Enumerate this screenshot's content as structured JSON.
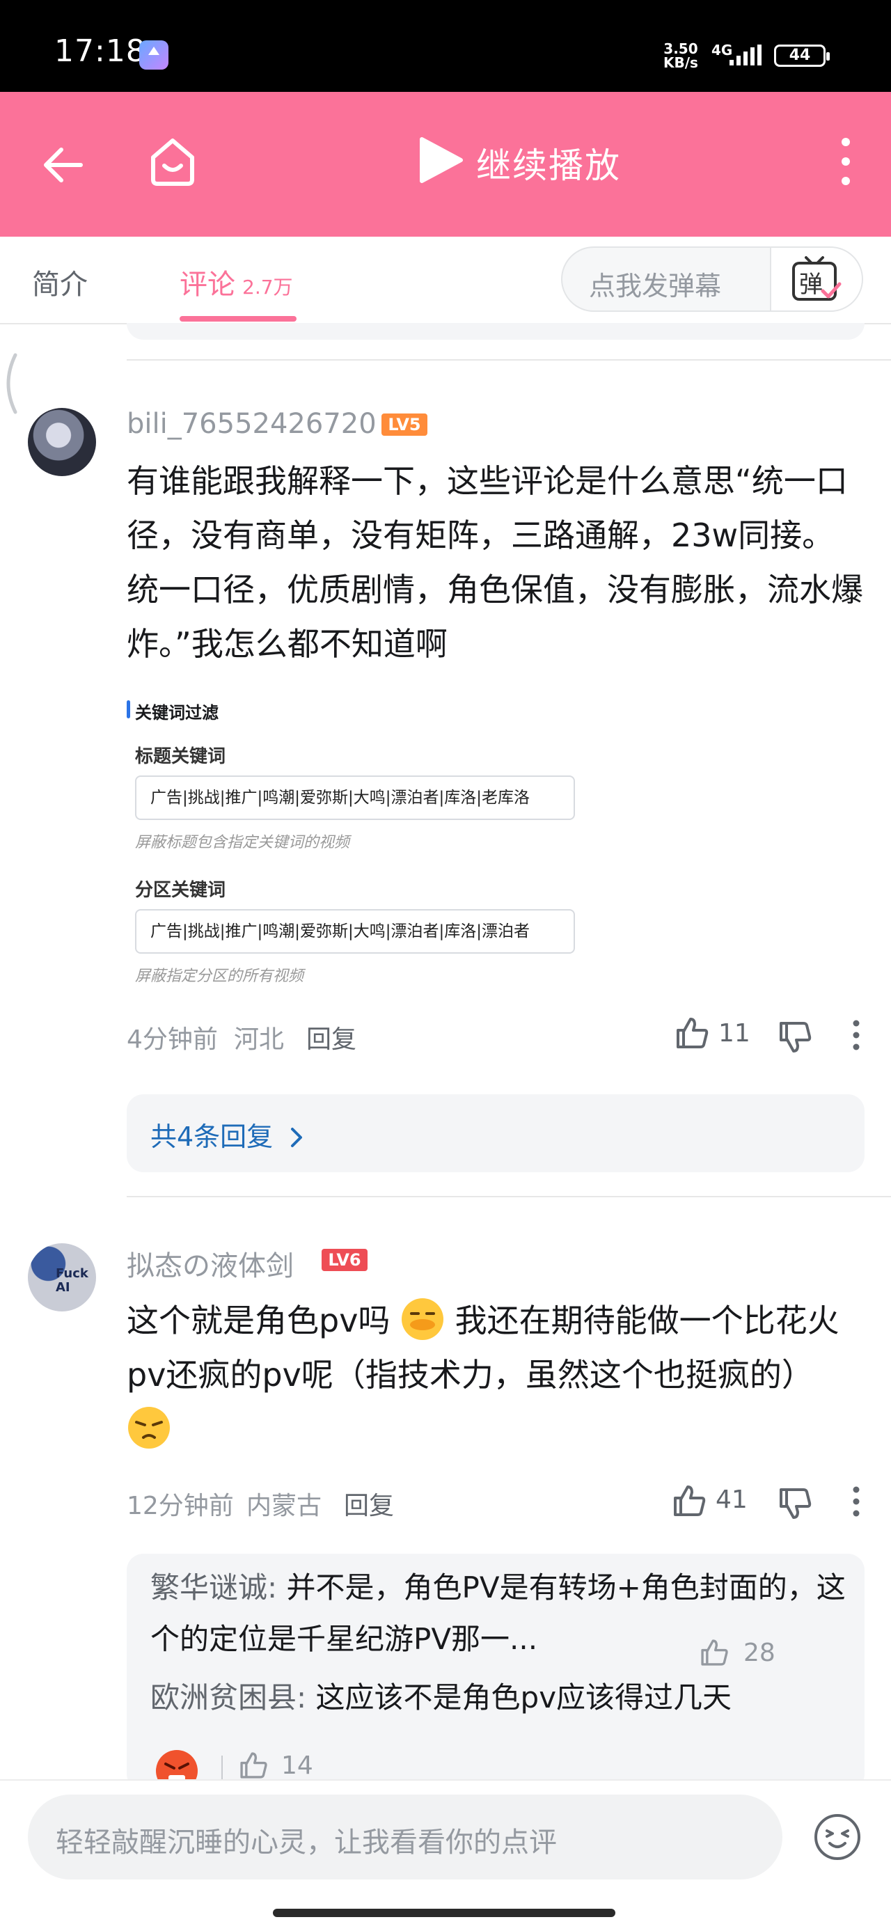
{
  "status_bar": {
    "time": "17:18",
    "net_speed_value": "3.50",
    "net_speed_unit": "KB/s",
    "network": "4G",
    "battery": "44"
  },
  "top_bar": {
    "play_label": "继续播放",
    "accent_color": "#fb7299"
  },
  "tabs": {
    "intro": "简介",
    "comments": "评论",
    "comments_count": "2.7万",
    "danmaku_placeholder": "点我发弹幕",
    "danmaku_button": "弹"
  },
  "comments": [
    {
      "username": "bili_76552426720",
      "level": "LV5",
      "text": "有谁能跟我解释一下，这些评论是什么意思“统一口径，没有商单，没有矩阵，三路通解，23w同接。统一口径，优质剧情，角色保值，没有膨胀，流水爆炸。”我怎么都不知道啊",
      "image": {
        "section_title": "关键词过滤",
        "title_keywords_label": "标题关键词",
        "title_keywords_value": "广告|挑战|推广|鸣潮|爱弥斯|大鸣|漂泊者|库洛|老库洛",
        "title_keywords_hint": "屏蔽标题包含指定关键词的视频",
        "zone_keywords_label": "分区关键词",
        "zone_keywords_value": "广告|挑战|推广|鸣潮|爱弥斯|大鸣|漂泊者|库洛|漂泊者",
        "zone_keywords_hint": "屏蔽指定分区的所有视频"
      },
      "time": "4分钟前",
      "location": "河北",
      "reply_label": "回复",
      "likes": "11",
      "replies_summary": "共4条回复"
    },
    {
      "username": "拟态の液体剑",
      "level": "LV6",
      "text_part1": "这个就是角色pv吗",
      "text_part2": "我还在期待能做一个比花火pv还疯的pv呢（指技术力，虽然这个也挺疯的）",
      "avatar_text": "Fuck AI",
      "time": "12分钟前",
      "location": "内蒙古",
      "reply_label": "回复",
      "likes": "41",
      "sub_replies": [
        {
          "user": "繁华谜诚",
          "text": "并不是，角色PV是有转场+角色封面的，这个的定位是千星纪游PV那一...",
          "likes": "28"
        },
        {
          "user": "欧洲贫困县",
          "text": "这应该不是角色pv应该得过几天",
          "likes": "14"
        }
      ]
    }
  ],
  "bottom": {
    "input_placeholder": "轻轻敲醒沉睡的心灵，让我看看你的点评"
  }
}
